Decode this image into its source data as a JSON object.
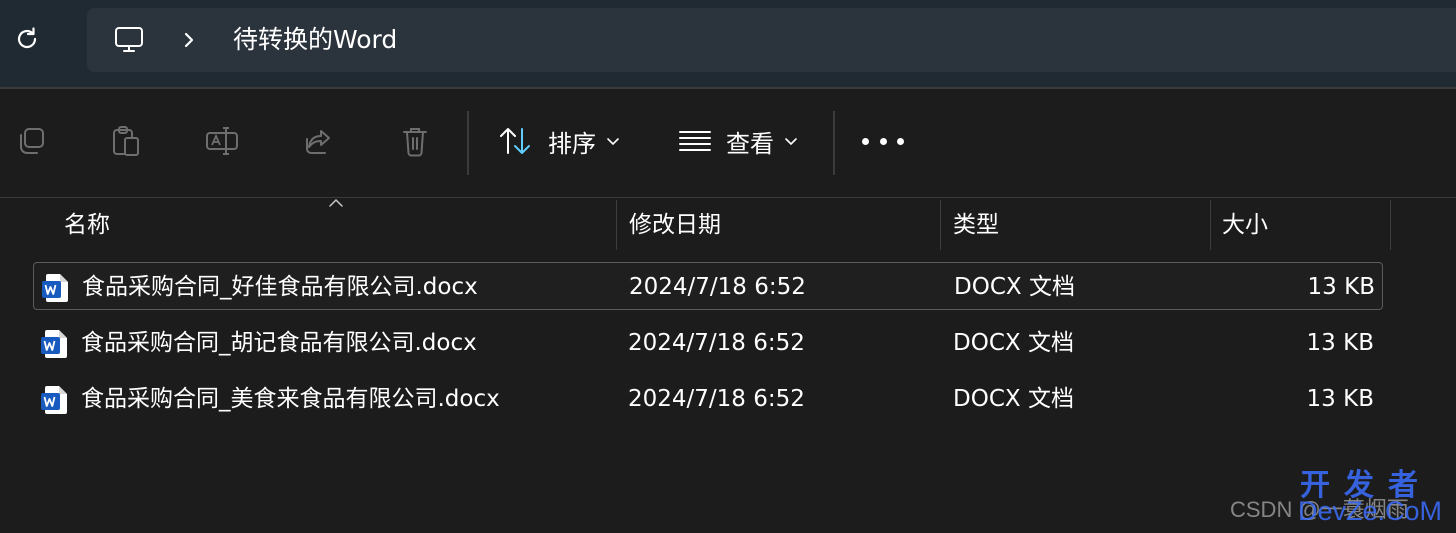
{
  "address_bar": {
    "breadcrumb_location": "待转换的Word"
  },
  "toolbar": {
    "sort_label": "排序",
    "view_label": "查看"
  },
  "columns": {
    "name": "名称",
    "modified": "修改日期",
    "type": "类型",
    "size": "大小"
  },
  "files": [
    {
      "name": "食品采购合同_好佳食品有限公司.docx",
      "modified": "2024/7/18 6:52",
      "type": "DOCX 文档",
      "size": "13 KB"
    },
    {
      "name": "食品采购合同_胡记食品有限公司.docx",
      "modified": "2024/7/18 6:52",
      "type": "DOCX 文档",
      "size": "13 KB"
    },
    {
      "name": "食品采购合同_美食来食品有限公司.docx",
      "modified": "2024/7/18 6:52",
      "type": "DOCX 文档",
      "size": "13 KB"
    }
  ],
  "watermark": {
    "csdn": "CSDN @一蓑烟雨",
    "site_cn": "开发者",
    "site_en": "DevZe.CoM"
  },
  "colors": {
    "background": "#1c1c1c",
    "address_bar": "#2b343d",
    "accent_blue": "#60cdff",
    "word_icon_blue": "#185abd"
  }
}
